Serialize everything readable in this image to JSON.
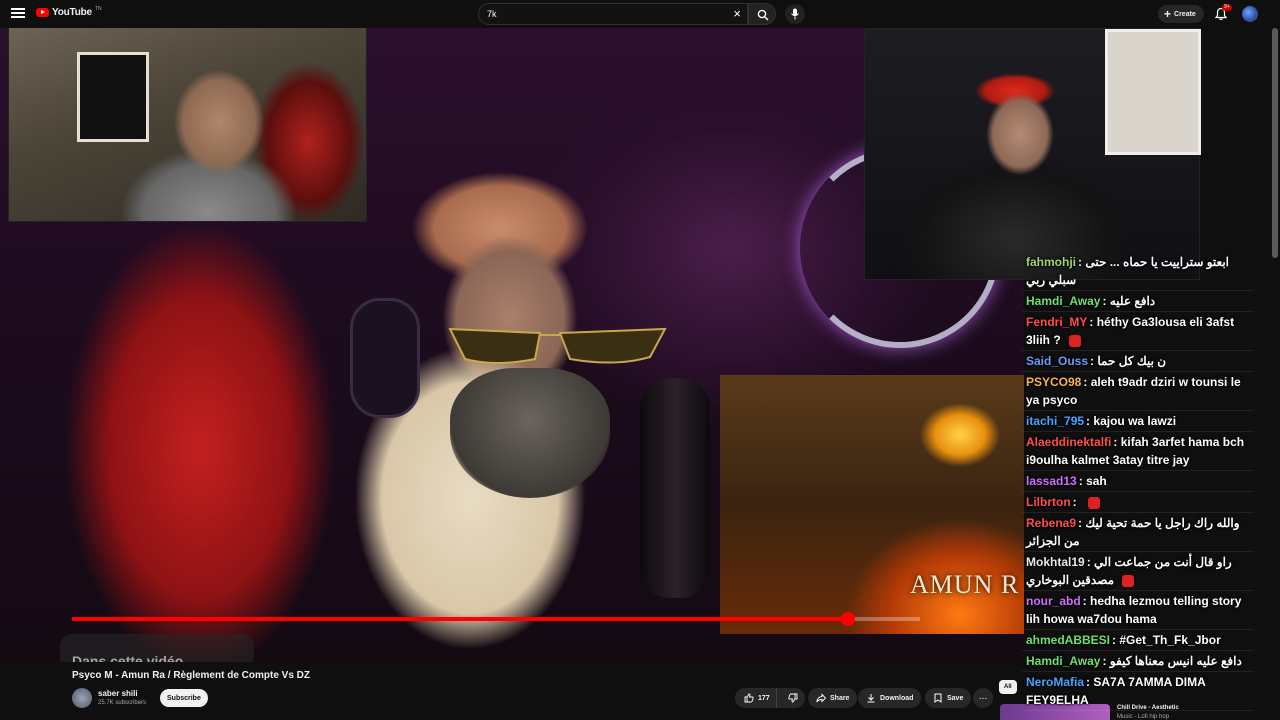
{
  "masthead": {
    "logo_text": "YouTube",
    "logo_sup": "TN",
    "search_value": "7k",
    "create_label": "Create",
    "notification_badge": "9+"
  },
  "video": {
    "cover_title": "AMUN R",
    "in_video_label": "Dans cette vidéo",
    "progress_fraction": 0.915
  },
  "chat": [
    {
      "author": "fahmohji",
      "color": "#9bd86b",
      "text": "ابعتو ستراييت يا حماه ... حتى سبلي ربي"
    },
    {
      "author": "Hamdi_Away",
      "color": "#6ee06e",
      "text": "دافع عليه"
    },
    {
      "author": "Fendri_MY",
      "color": "#ff4d4d",
      "text": "héthy Ga3lousa eli 3afst 3liih ?",
      "emote": true
    },
    {
      "author": "Said_Ouss",
      "color": "#6f9cff",
      "text": "ن بيك كل حما"
    },
    {
      "author": "PSYCO98",
      "color": "#ffb14a",
      "text": "aleh t9adr dziri w tounsi le ya psyco"
    },
    {
      "author": "itachi_795",
      "color": "#4aa3ff",
      "text": "kajou wa lawzi"
    },
    {
      "author": "Alaeddinektalfi",
      "color": "#ff4d4d",
      "text": "kifah 3arfet hama bch i9oulha kalmet 3atay titre jay"
    },
    {
      "author": "lassad13",
      "color": "#d070ff",
      "text": "sah"
    },
    {
      "author": "Lilbrton",
      "color": "#ff4d4d",
      "text": "",
      "emote": true
    },
    {
      "author": "Rebena9",
      "color": "#ff4d4d",
      "text": "والله راك راجل يا حمة تحية ليك من الجزائر"
    },
    {
      "author": "Mokhtal19",
      "color": "#e8e8e8",
      "text": "راو قال أنت من جماعت الي مصدقين البوخاري",
      "emote": true
    },
    {
      "author": "nour_abd",
      "color": "#d070ff",
      "text": "hedha lezmou telling story lih howa wa7dou hama"
    },
    {
      "author": "ahmedABBESI",
      "color": "#6ee06e",
      "text": "#Get_Th_Fk_Jbor"
    },
    {
      "author": "Hamdi_Away",
      "color": "#6ee06e",
      "text": "دافع عليه انيس معناها كيفو"
    },
    {
      "author": "NeroMafia",
      "color": "#4aa3ff",
      "text": "SA7A 7AMMA DIMA FEY9ELHA"
    }
  ],
  "details": {
    "title": "Psyco M - Amun Ra / Règlement de Compte Vs DZ",
    "channel_name": "saber shili",
    "subscribers": "25.7K subscribers",
    "subscribe_label": "Subscribe",
    "likes": "177",
    "share_label": "Share",
    "download_label": "Download",
    "save_label": "Save",
    "more_label": "...",
    "chip_all": "All",
    "rec_title": "Chill Drive - Aesthetic",
    "rec_title2": "Music - Lofi hip hop"
  },
  "colors": {
    "accent": "#ff0000",
    "background": "#0f0f0f"
  }
}
